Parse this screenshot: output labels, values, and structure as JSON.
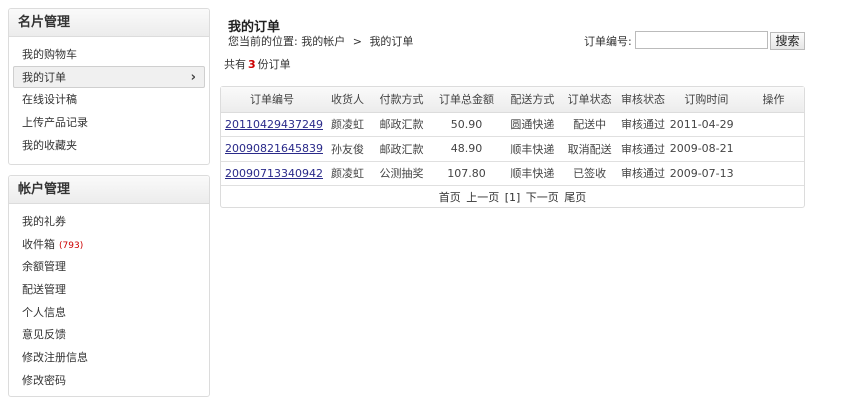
{
  "sidebar": {
    "card_section": {
      "title": "名片管理",
      "items": [
        {
          "label": "我的购物车"
        },
        {
          "label": "我的订单",
          "active": true,
          "chevron": "›"
        },
        {
          "label": "在线设计稿"
        },
        {
          "label": "上传产品记录"
        },
        {
          "label": "我的收藏夹"
        }
      ]
    },
    "account_section": {
      "title": "帐户管理",
      "items": [
        {
          "label": "我的礼券"
        },
        {
          "label": "收件箱",
          "count": "(793)"
        },
        {
          "label": "余额管理"
        },
        {
          "label": "配送管理"
        },
        {
          "label": "个人信息"
        },
        {
          "label": "意见反馈"
        },
        {
          "label": "修改注册信息"
        },
        {
          "label": "修改密码"
        }
      ]
    }
  },
  "main": {
    "title": "我的订单",
    "breadcrumb": {
      "prefix": "您当前的位置:",
      "items": [
        "我的帐户",
        "我的订单"
      ],
      "separator": ">"
    },
    "search": {
      "label": "订单编号:",
      "value": "",
      "button": "搜索"
    },
    "summary": {
      "prefix": "共有",
      "count": "3",
      "suffix": "份订单"
    },
    "table": {
      "headers": [
        "订单编号",
        "收货人",
        "付款方式",
        "订单总金额",
        "配送方式",
        "订单状态",
        "审核状态",
        "订购时间",
        "操作"
      ],
      "rows": [
        [
          "20110429437249",
          "颜凌虹",
          "邮政汇款",
          "50.90",
          "圆通快递",
          "配送中",
          "审核通过",
          "2011-04-29",
          ""
        ],
        [
          "20090821645839",
          "孙友俊",
          "邮政汇款",
          "48.90",
          "顺丰快递",
          "取消配送",
          "审核通过",
          "2009-08-21",
          ""
        ],
        [
          "20090713340942",
          "颜凌虹",
          "公测抽奖",
          "107.80",
          "顺丰快递",
          "已签收",
          "审核通过",
          "2009-07-13",
          ""
        ]
      ]
    },
    "pager": {
      "first": "首页",
      "prev": "上一页",
      "current": "[1]",
      "next": "下一页",
      "last": "尾页"
    }
  }
}
